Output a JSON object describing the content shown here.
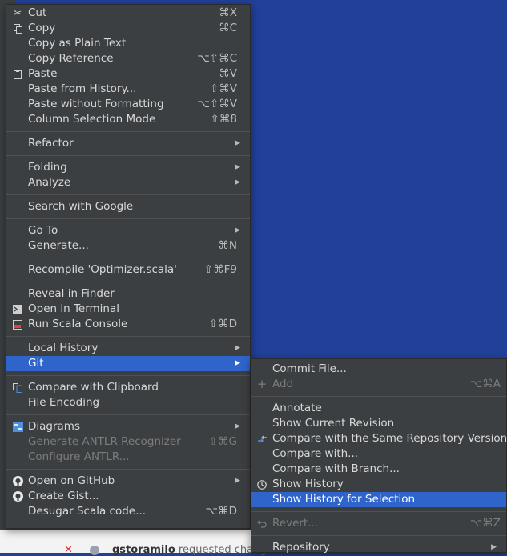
{
  "context_menu": {
    "items": [
      {
        "label": "Cut",
        "shortcut": "⌘X",
        "icon": "scissors-icon"
      },
      {
        "label": "Copy",
        "shortcut": "⌘C",
        "icon": "copy-icon"
      },
      {
        "label": "Copy as Plain Text",
        "shortcut": ""
      },
      {
        "label": "Copy Reference",
        "shortcut": "⌥⇧⌘C"
      },
      {
        "label": "Paste",
        "shortcut": "⌘V",
        "icon": "clipboard-icon"
      },
      {
        "label": "Paste from History...",
        "shortcut": "⇧⌘V"
      },
      {
        "label": "Paste without Formatting",
        "shortcut": "⌥⇧⌘V"
      },
      {
        "label": "Column Selection Mode",
        "shortcut": "⇧⌘8"
      },
      {
        "label": "Refactor",
        "submenu": true
      },
      {
        "label": "Folding",
        "submenu": true
      },
      {
        "label": "Analyze",
        "submenu": true
      },
      {
        "label": "Search with Google"
      },
      {
        "label": "Go To",
        "submenu": true
      },
      {
        "label": "Generate...",
        "shortcut": "⌘N"
      },
      {
        "label": "Recompile 'Optimizer.scala'",
        "shortcut": "⇧⌘F9"
      },
      {
        "label": "Reveal in Finder"
      },
      {
        "label": "Open in Terminal",
        "icon": "terminal-icon"
      },
      {
        "label": "Run Scala Console",
        "shortcut": "⇧⌘D",
        "icon": "scala-console-icon"
      },
      {
        "label": "Local History",
        "submenu": true
      },
      {
        "label": "Git",
        "submenu": true,
        "selected": true
      },
      {
        "label": "Compare with Clipboard",
        "icon": "compare-icon"
      },
      {
        "label": "File Encoding"
      },
      {
        "label": "Diagrams",
        "submenu": true,
        "icon": "diagram-icon"
      },
      {
        "label": "Generate ANTLR Recognizer",
        "shortcut": "⇧⌘G",
        "disabled": true
      },
      {
        "label": "Configure ANTLR...",
        "disabled": true
      },
      {
        "label": "Open on GitHub",
        "submenu": true,
        "icon": "github-icon"
      },
      {
        "label": "Create Gist...",
        "icon": "github-icon"
      },
      {
        "label": "Desugar Scala code...",
        "shortcut": "⌥⌘D"
      }
    ]
  },
  "git_submenu": {
    "items": [
      {
        "label": "Commit File..."
      },
      {
        "label": "Add",
        "shortcut": "⌥⌘A",
        "disabled": true,
        "icon": "plus-icon"
      },
      {
        "label": "Annotate"
      },
      {
        "label": "Show Current Revision"
      },
      {
        "label": "Compare with the Same Repository Version",
        "icon": "compare-arrows-icon"
      },
      {
        "label": "Compare with..."
      },
      {
        "label": "Compare with Branch..."
      },
      {
        "label": "Show History",
        "icon": "clock-icon"
      },
      {
        "label": "Show History for Selection",
        "selected": true
      },
      {
        "label": "Revert...",
        "shortcut": "⌥⌘Z",
        "disabled": true,
        "icon": "revert-icon"
      },
      {
        "label": "Repository",
        "submenu": true
      }
    ]
  },
  "background": {
    "comment_user": "gstoramilo",
    "comment_text": "requested chang"
  },
  "colors": {
    "menu_bg": "#3c3f41",
    "selection": "#2f65ca",
    "desktop": "#21409a"
  }
}
